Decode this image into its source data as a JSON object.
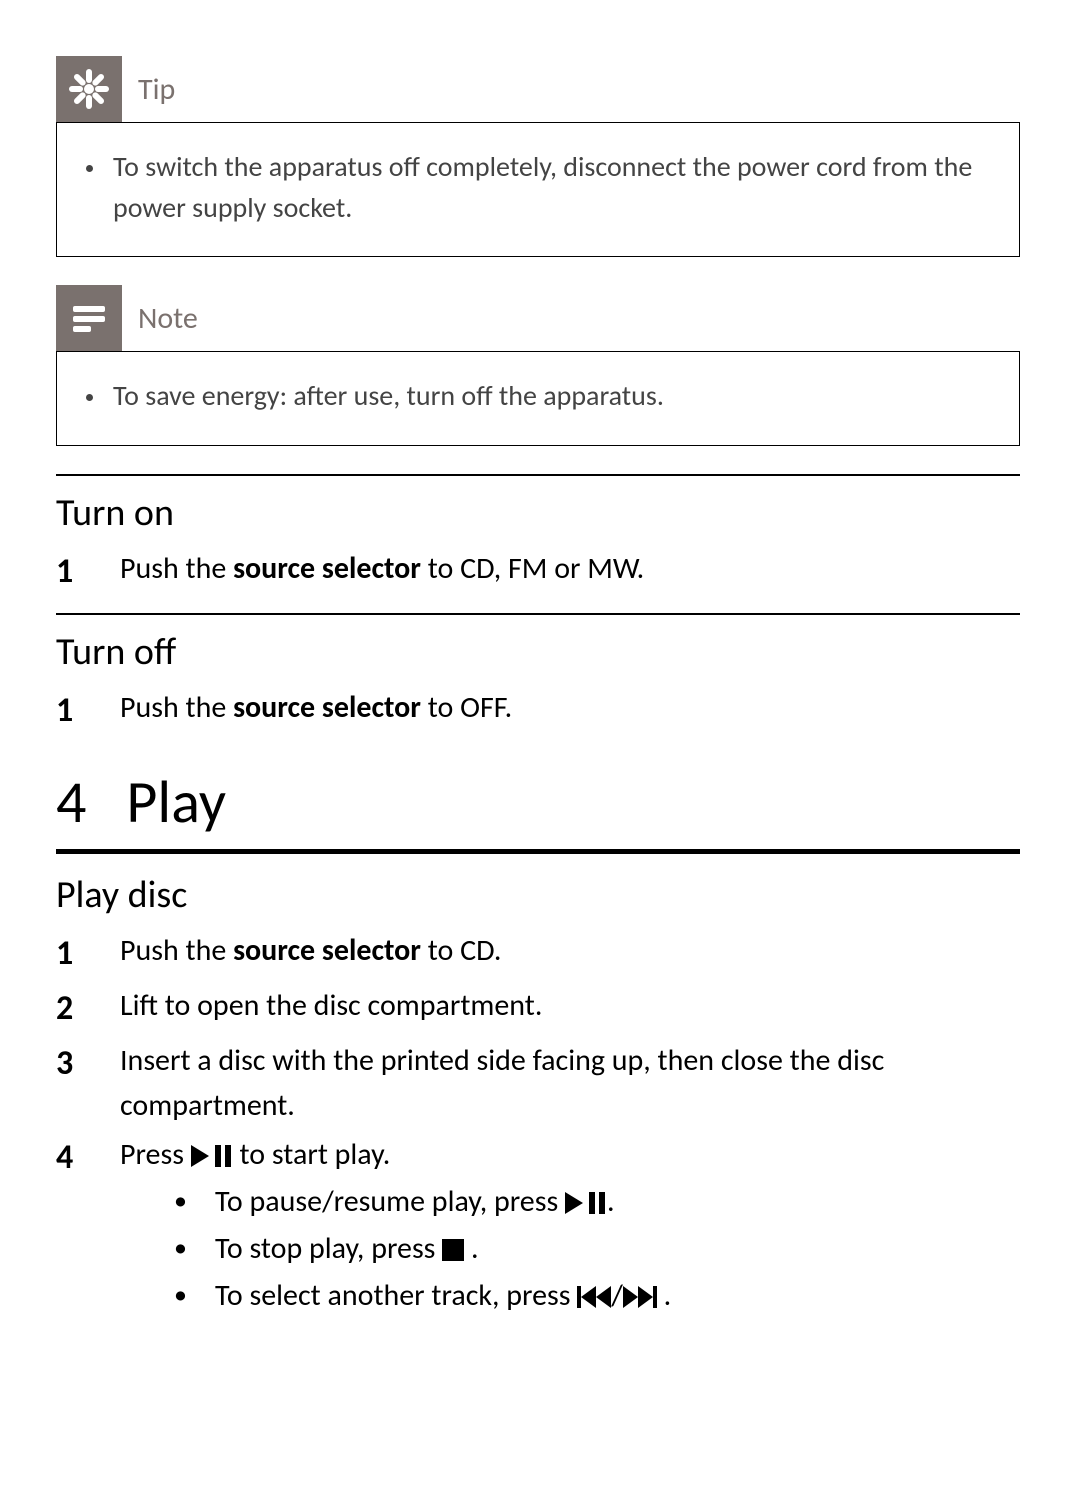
{
  "tip": {
    "label": "Tip",
    "items": [
      "To switch the apparatus off completely, disconnect the power cord from the power supply socket."
    ]
  },
  "note": {
    "label": "Note",
    "items": [
      "To save energy: after use, turn off the apparatus."
    ]
  },
  "turn_on": {
    "title": "Turn on",
    "step1_pre": "Push the ",
    "step1_bold": "source selector",
    "step1_post": " to CD, FM or MW."
  },
  "turn_off": {
    "title": "Turn off",
    "step1_pre": "Push the ",
    "step1_bold": "source selector",
    "step1_post": " to OFF."
  },
  "chapter": {
    "number": "4",
    "title": "Play"
  },
  "play_disc": {
    "title": "Play disc",
    "step1_pre": "Push the ",
    "step1_bold": "source selector",
    "step1_post": " to CD.",
    "step2": "Lift to open the disc compartment.",
    "step3": "Insert a disc with the printed side facing up, then close the disc compartment.",
    "step4_pre": "Press ",
    "step4_post": " to start play.",
    "sub1_pre": "To pause/resume play, press ",
    "sub1_post": ".",
    "sub2_pre": "To stop play, press ",
    "sub2_post": " .",
    "sub3_pre": "To select another track, press ",
    "sub3_sep": "/",
    "sub3_post": " ."
  }
}
